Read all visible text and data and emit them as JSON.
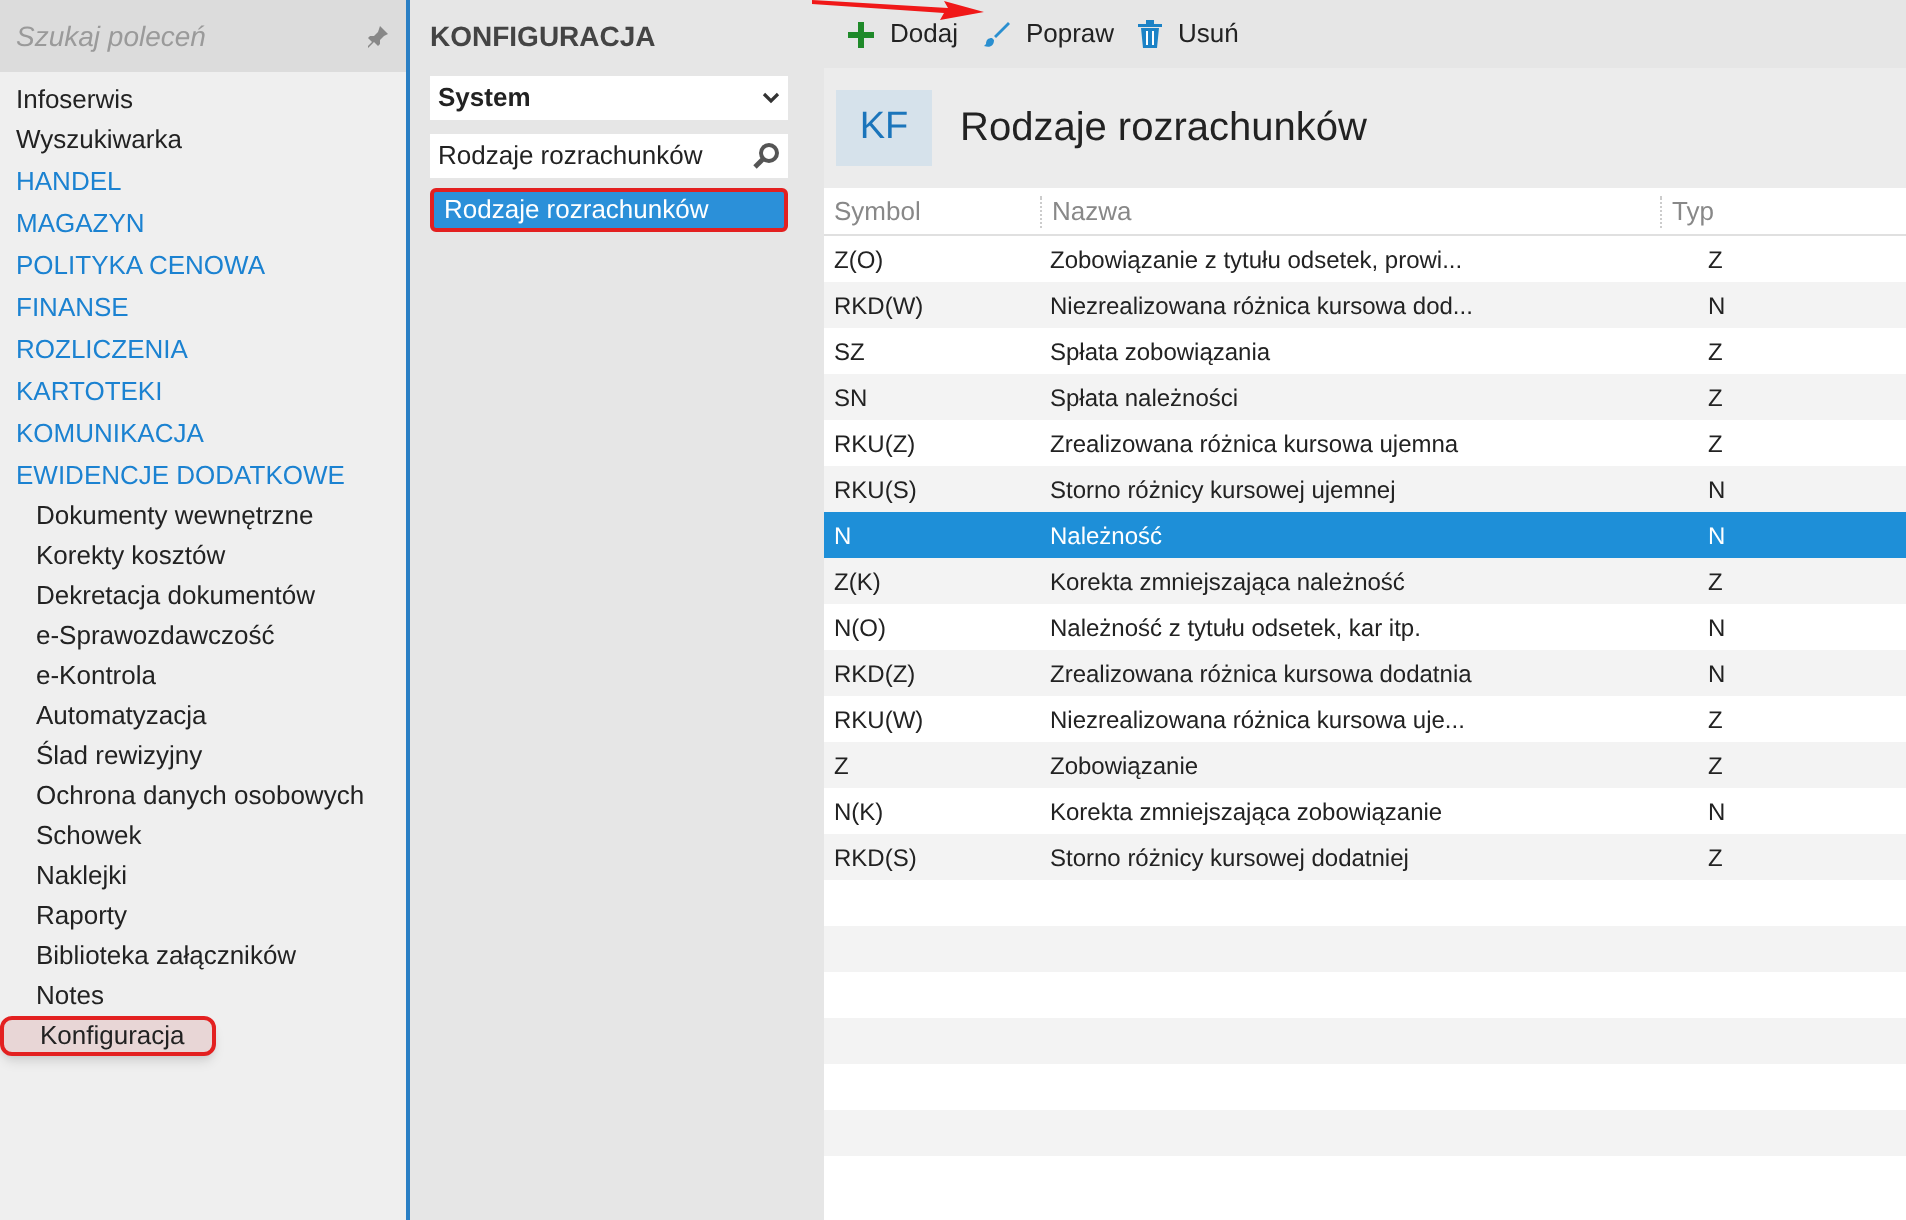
{
  "sidebar": {
    "search": {
      "placeholder": "Szukaj poleceń"
    },
    "items": [
      {
        "label": "Infoserwis",
        "kind": "link",
        "selected": false
      },
      {
        "label": "Wyszukiwarka",
        "kind": "link",
        "selected": false
      },
      {
        "label": "HANDEL",
        "kind": "category",
        "selected": false
      },
      {
        "label": "MAGAZYN",
        "kind": "category",
        "selected": false
      },
      {
        "label": "POLITYKA CENOWA",
        "kind": "category",
        "selected": false
      },
      {
        "label": "FINANSE",
        "kind": "category",
        "selected": false
      },
      {
        "label": "ROZLICZENIA",
        "kind": "category",
        "selected": false
      },
      {
        "label": "KARTOTEKI",
        "kind": "category",
        "selected": false
      },
      {
        "label": "KOMUNIKACJA",
        "kind": "category",
        "selected": false
      },
      {
        "label": "EWIDENCJE DODATKOWE",
        "kind": "category",
        "selected": false
      },
      {
        "label": "Dokumenty wewnętrzne",
        "kind": "sub",
        "selected": false
      },
      {
        "label": "Korekty kosztów",
        "kind": "sub",
        "selected": false
      },
      {
        "label": "Dekretacja dokumentów",
        "kind": "sub",
        "selected": false
      },
      {
        "label": "e-Sprawozdawczość",
        "kind": "sub",
        "selected": false
      },
      {
        "label": "e-Kontrola",
        "kind": "sub",
        "selected": false
      },
      {
        "label": "Automatyzacja",
        "kind": "sub",
        "selected": false
      },
      {
        "label": "Ślad rewizyjny",
        "kind": "sub",
        "selected": false
      },
      {
        "label": "Ochrona danych osobowych",
        "kind": "sub",
        "selected": false
      },
      {
        "label": "Schowek",
        "kind": "sub",
        "selected": false
      },
      {
        "label": "Naklejki",
        "kind": "sub",
        "selected": false
      },
      {
        "label": "Raporty",
        "kind": "sub",
        "selected": false
      },
      {
        "label": "Biblioteka załączników",
        "kind": "sub",
        "selected": false
      },
      {
        "label": "Notes",
        "kind": "sub",
        "selected": false
      },
      {
        "label": "Konfiguracja",
        "kind": "sub",
        "selected": true
      }
    ]
  },
  "config_panel": {
    "title": "KONFIGURACJA",
    "dropdown": "System",
    "search": {
      "value": "Rodzaje rozrachunków"
    },
    "results": [
      {
        "label": "Rodzaje rozrachunków",
        "selected": true
      }
    ]
  },
  "toolbar": [
    {
      "label": "Dodaj",
      "kind": "add"
    },
    {
      "label": "Popraw",
      "kind": "edit"
    },
    {
      "label": "Usuń",
      "kind": "delete"
    }
  ],
  "header": {
    "badge": "KF",
    "title": "Rodzaje rozrachunków"
  },
  "table": {
    "columns": [
      "Symbol",
      "Nazwa",
      "Typ"
    ],
    "rows": [
      {
        "cells": [
          "Z(O)",
          "Zobowiązanie z tytułu odsetek, prowi...",
          "Z"
        ],
        "selected": false
      },
      {
        "cells": [
          "RKD(W)",
          "Niezrealizowana różnica kursowa dod...",
          "N"
        ],
        "selected": false
      },
      {
        "cells": [
          "SZ",
          "Spłata zobowiązania",
          "Z"
        ],
        "selected": false
      },
      {
        "cells": [
          "SN",
          "Spłata należności",
          "Z"
        ],
        "selected": false
      },
      {
        "cells": [
          "RKU(Z)",
          "Zrealizowana różnica kursowa ujemna",
          "Z"
        ],
        "selected": false
      },
      {
        "cells": [
          "RKU(S)",
          "Storno różnicy kursowej ujemnej",
          "N"
        ],
        "selected": false
      },
      {
        "cells": [
          "N",
          "Należność",
          "N"
        ],
        "selected": true
      },
      {
        "cells": [
          "Z(K)",
          "Korekta zmniejszająca należność",
          "Z"
        ],
        "selected": false
      },
      {
        "cells": [
          "N(O)",
          "Należność z tytułu odsetek, kar itp.",
          "N"
        ],
        "selected": false
      },
      {
        "cells": [
          "RKD(Z)",
          "Zrealizowana różnica kursowa dodatnia",
          "N"
        ],
        "selected": false
      },
      {
        "cells": [
          "RKU(W)",
          "Niezrealizowana różnica kursowa uje...",
          "Z"
        ],
        "selected": false
      },
      {
        "cells": [
          "Z",
          "Zobowiązanie",
          "Z"
        ],
        "selected": false
      },
      {
        "cells": [
          "N(K)",
          "Korekta zmniejszająca zobowiązanie",
          "N"
        ],
        "selected": false
      },
      {
        "cells": [
          "RKD(S)",
          "Storno różnicy kursowej dodatniej",
          "Z"
        ],
        "selected": false
      }
    ]
  }
}
